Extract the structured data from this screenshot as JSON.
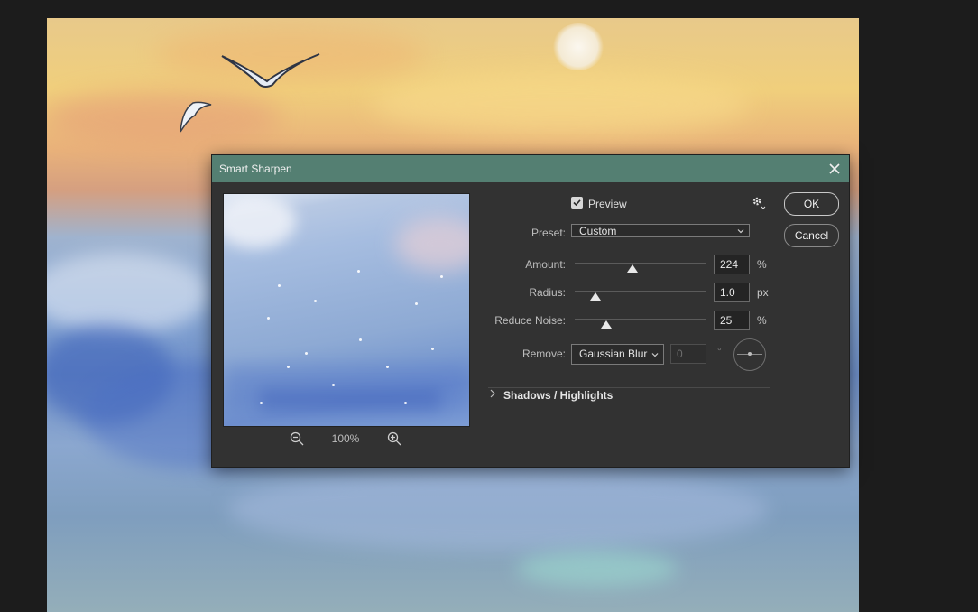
{
  "dialog": {
    "title": "Smart Sharpen",
    "preview_label": "Preview",
    "preview_checked": true,
    "zoom_level": "100%",
    "preset": {
      "label": "Preset:",
      "value": "Custom"
    },
    "amount": {
      "label": "Amount:",
      "value": "224",
      "unit": "%",
      "slider_fraction": 0.44
    },
    "radius": {
      "label": "Radius:",
      "value": "1.0",
      "unit": "px",
      "slider_fraction": 0.16
    },
    "reduce_noise": {
      "label": "Reduce Noise:",
      "value": "25",
      "unit": "%",
      "slider_fraction": 0.24
    },
    "remove": {
      "label": "Remove:",
      "value": "Gaussian Blur",
      "angle_value": "0",
      "angle_unit": "°"
    },
    "shadows_highlights_label": "Shadows / Highlights",
    "ok_label": "OK",
    "cancel_label": "Cancel"
  },
  "icons": {
    "close": "close-icon",
    "settings": "gear-icon",
    "zoom_out": "zoom-out-icon",
    "zoom_in": "zoom-in-icon",
    "expand": "chevron-right-icon",
    "dropdown": "chevron-down-icon"
  },
  "colors": {
    "titlebar": "#547f72",
    "dialog_bg": "#323232"
  }
}
